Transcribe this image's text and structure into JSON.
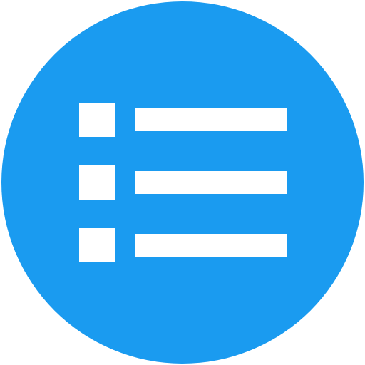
{
  "app_icon": {
    "icon_name": "list-icon",
    "colors": {
      "circle": "#1A9BF0",
      "glyph": "#FFFFFF"
    },
    "rows": [
      {
        "bullet_shape": "square",
        "line_shape": "bar"
      },
      {
        "bullet_shape": "square",
        "line_shape": "bar"
      },
      {
        "bullet_shape": "square",
        "line_shape": "bar"
      }
    ]
  }
}
